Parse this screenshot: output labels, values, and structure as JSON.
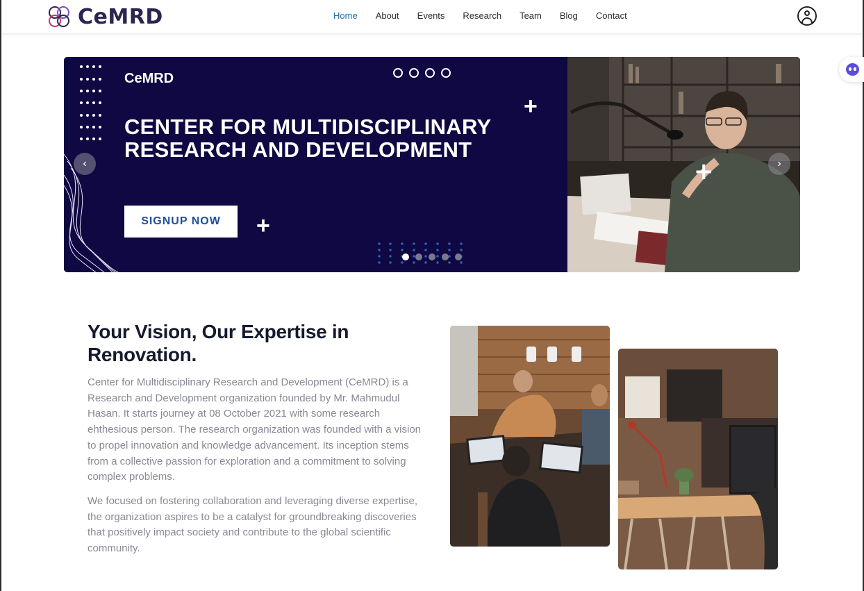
{
  "header": {
    "logo_text": "CeMRD",
    "nav": [
      {
        "label": "Home",
        "active": true
      },
      {
        "label": "About",
        "active": false
      },
      {
        "label": "Events",
        "active": false
      },
      {
        "label": "Research",
        "active": false
      },
      {
        "label": "Team",
        "active": false
      },
      {
        "label": "Blog",
        "active": false
      },
      {
        "label": "Contact",
        "active": false
      }
    ],
    "user_icon": "user-circle-icon",
    "accent_color": "#1f6fa8"
  },
  "hero": {
    "brand": "CeMRD",
    "title": "CENTER FOR MULTIDISCIPLINARY RESEARCH AND DEVELOPMENT",
    "signup_label": "SIGNUP NOW",
    "background_color": "#100843",
    "prev_icon": "chevron-left-icon",
    "next_icon": "chevron-right-icon",
    "slide_count": 5,
    "active_slide": 1
  },
  "chat_widget": {
    "icon": "chat-bot-icon"
  },
  "about": {
    "title": "Your Vision, Our Expertise in Renovation.",
    "paragraph1": "Center for Multidisciplinary Research and Development (CeMRD) is a Research and Development organization founded by Mr. Mahmudul Hasan. It starts journey at 08 October 2021 with some research ehthesious person. The research organization was founded with a vision to propel innovation and knowledge advancement. Its inception stems from a collective passion for exploration and a commitment to solving complex problems.",
    "paragraph2": "We focused on fostering collaboration and leveraging diverse expertise, the organization aspires to be a catalyst for groundbreaking discoveries that positively impact society and contribute to the global scientific community."
  }
}
